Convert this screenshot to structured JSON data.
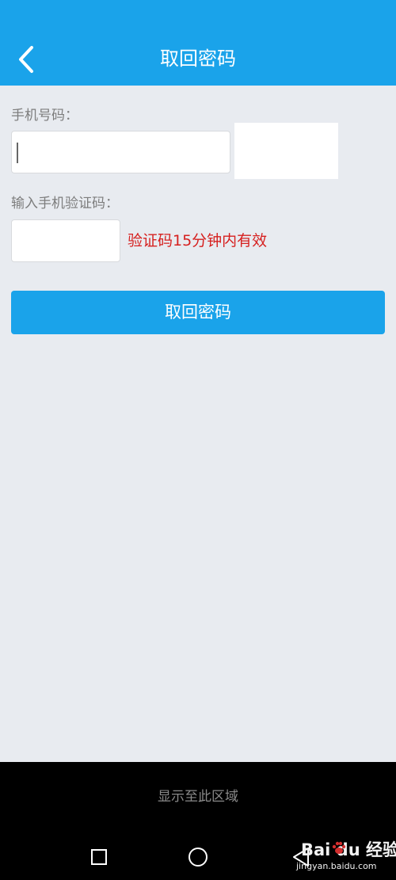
{
  "header": {
    "title": "取回密码",
    "back_icon": "chevron-left-icon"
  },
  "form": {
    "phone_label": "手机号码：",
    "phone_value": "",
    "sms_label": "输入手机验证码：",
    "sms_value": "",
    "validity_note": "验证码15分钟内有效",
    "submit_label": "取回密码"
  },
  "bottom_panel": {
    "text": "显示至此区域"
  },
  "navigation": {
    "items": [
      "recent-apps-icon",
      "home-icon",
      "back-icon"
    ]
  },
  "watermark": {
    "brand": "Bai du 经验",
    "url": "jingyan.baidu.com"
  },
  "colors": {
    "primary": "#1aa3ea",
    "background": "#e8ebf0",
    "error_red": "#d6201f",
    "label_gray": "#7d7d7d"
  }
}
